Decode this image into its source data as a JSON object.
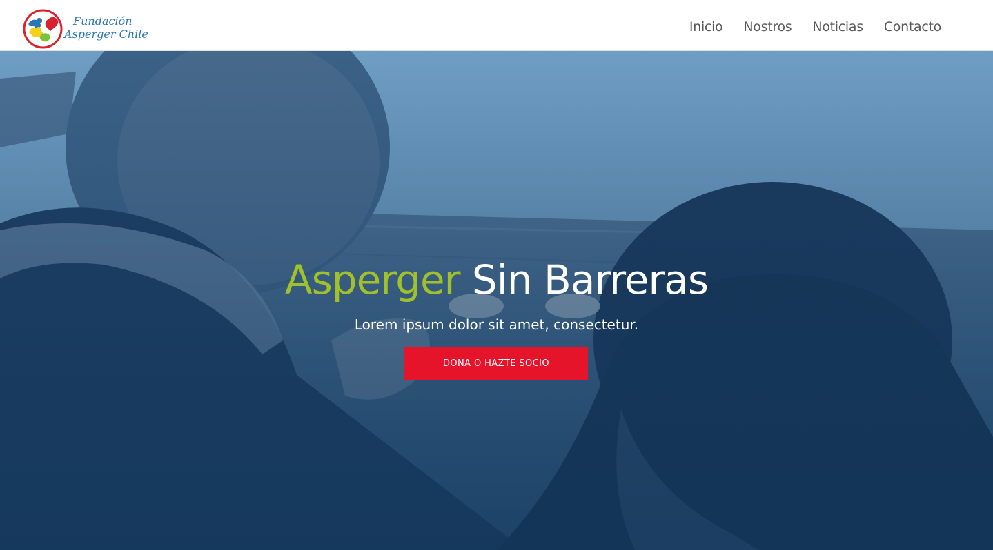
{
  "header": {
    "logo": {
      "line1": "Fundación",
      "line2": "Asperger Chile"
    },
    "nav": [
      {
        "label": "Inicio"
      },
      {
        "label": "Nostros"
      },
      {
        "label": "Noticias"
      },
      {
        "label": "Contacto"
      }
    ]
  },
  "hero": {
    "title_accent": "Asperger",
    "title_rest": " Sin Barreras",
    "subtitle": "Lorem ipsum dolor sit amet, consectetur.",
    "cta_label": "DONA O HAZTE SOCIO"
  },
  "colors": {
    "accent_green": "#a2c02a",
    "cta_red": "#e5142a",
    "nav_text": "#5a5a5a",
    "hero_overlay": "#1f4a72"
  }
}
